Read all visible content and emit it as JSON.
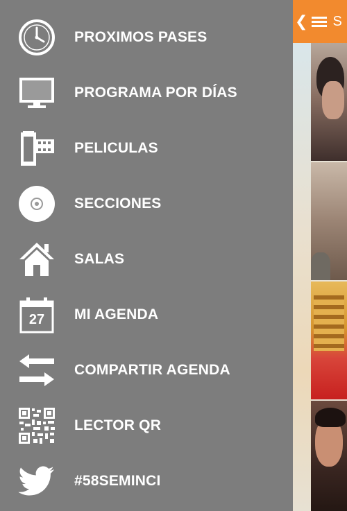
{
  "drawer": {
    "items": [
      {
        "label": "PROXIMOS PASES",
        "icon": "clock-icon"
      },
      {
        "label": "PROGRAMA POR DÍAS",
        "icon": "monitor-icon"
      },
      {
        "label": "PELICULAS",
        "icon": "film-roll-icon"
      },
      {
        "label": "SECCIONES",
        "icon": "disc-icon"
      },
      {
        "label": "SALAS",
        "icon": "home-icon"
      },
      {
        "label": "MI AGENDA",
        "icon": "calendar-icon",
        "calendar_day": "27"
      },
      {
        "label": "COMPARTIR AGENDA",
        "icon": "share-arrows-icon"
      },
      {
        "label": "LECTOR QR",
        "icon": "qr-code-icon"
      },
      {
        "label": "#58SEMINCI",
        "icon": "twitter-bird-icon"
      }
    ]
  },
  "action_bar": {
    "back_glyph": "❮",
    "title": "S",
    "color": "#f28a2e"
  },
  "colors": {
    "drawer_bg": "#7d7d7d",
    "text": "#ffffff"
  }
}
